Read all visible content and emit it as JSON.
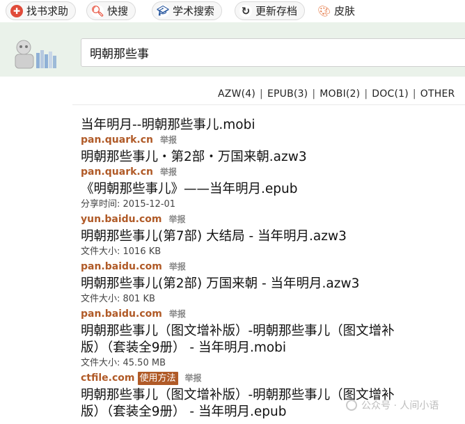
{
  "toolbar": {
    "btn_findbook": "找书求助",
    "btn_quick": "快搜",
    "btn_academic": "学术搜索",
    "btn_update": "更新存档",
    "btn_skin": "皮肤"
  },
  "search": {
    "value": "明朝那些事"
  },
  "filters": {
    "azw": "AZW(4)",
    "epub": "EPUB(3)",
    "mobi": "MOBI(2)",
    "doc": "DOC(1)",
    "other": "OTHER"
  },
  "results": [
    {
      "title": "当年明月--明朝那些事儿.mobi",
      "host": "pan.quark.cn",
      "report": "举报"
    },
    {
      "title": "明朝那些事儿・第2部・万国来朝.azw3",
      "host": "pan.quark.cn",
      "report": "举报"
    },
    {
      "title": "《明朝那些事儿》——当年明月.epub",
      "meta": "分享时间: 2015-12-01",
      "host": "yun.baidu.com",
      "report": "举报"
    },
    {
      "title": "明朝那些事儿(第7部) 大结局 - 当年明月.azw3",
      "meta": "文件大小: 1016 KB",
      "host": "pan.baidu.com",
      "report": "举报"
    },
    {
      "title": "明朝那些事儿(第2部) 万国来朝 - 当年明月.azw3",
      "meta": "文件大小: 801 KB",
      "host": "pan.baidu.com",
      "report": "举报"
    },
    {
      "title_l1": "明朝那些事儿（图文增补版）-明朝那些事儿（图文增补",
      "title_l2": "版）（套装全9册） - 当年明月.mobi",
      "meta": "文件大小: 45.50 MB",
      "host": "ctfile.com",
      "guide": "使用方法",
      "report": "举报"
    },
    {
      "title_l1": "明朝那些事儿（图文增补版）-明朝那些事儿（图文增补",
      "title_l2": "版）（套装全9册） - 当年明月.epub"
    }
  ],
  "watermark": "公众号 · 人间小语",
  "colors": {
    "host": "#b05a27",
    "search_band": "#eaf2ea"
  }
}
